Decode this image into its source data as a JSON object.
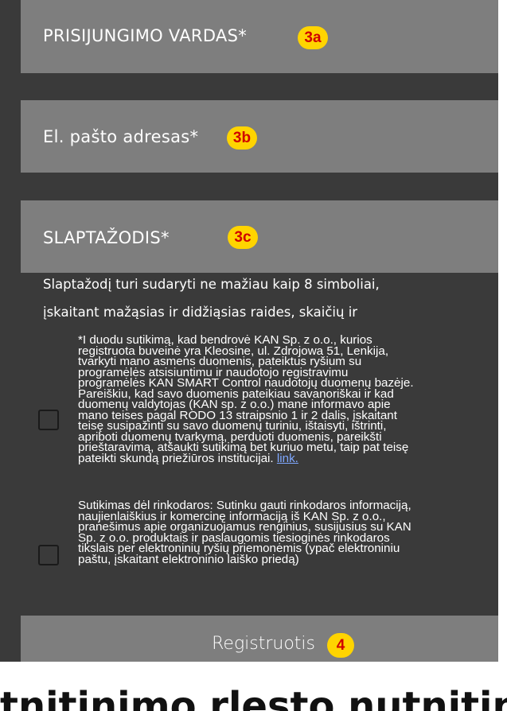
{
  "form": {
    "username": {
      "label": "PRISIJUNGIMO VARDAS*",
      "badge": "3a"
    },
    "email": {
      "label": "El. pašto adresas*",
      "badge": "3b"
    },
    "password": {
      "label": "SLAPTAŽODIS*",
      "badge": "3c"
    },
    "password_hint_line1": "Slaptažodį turi sudaryti ne mažiau kaip 8 simboliai,",
    "password_hint_line2": "įskaitant mažąsias ir didžiąsias raides, skaičių ir",
    "consent1": {
      "lines": [
        "*I duodu sutikimą, kad bendrovė KAN Sp. z o.o., kurios",
        "registruota buveinė yra Kleosine, ul. Zdrojowa 51, Lenkija,",
        "tvarkyti mano asmens duomenis, pateiktus ryšium su",
        "programėlės atsisiuntimu ir naudotojo registravimu",
        "programėlės KAN SMART Control naudotojų duomenų bazėje.",
        "Pareiškiu, kad savo duomenis pateikiau savanoriškai ir kad",
        "duomenų valdytojas (KAN sp. z o.o.) mane informavo apie",
        "mano teises pagal RODO 13 straipsnio 1 ir 2 dalis, įskaitant",
        "teisę susipažinti su savo duomenų turiniu, ištaisyti, ištrinti,",
        "apriboti duomenų tvarkymą, perduoti duomenis, pareikšti",
        "prieštaravimą, atšaukti sutikimą bet kuriuo metu, taip pat teisę"
      ],
      "last_line": "pateikti skundą priežiūros institucijai.",
      "link_text": "link."
    },
    "consent2": {
      "lines": [
        "Sutikimas dėl rinkodaros: Sutinku gauti rinkodaros informaciją,",
        "naujienlaiškius ir komercinę informaciją iš KAN Sp. z o.o.,",
        "pranešimus apie organizuojamus renginius, susijusius su KAN",
        "Sp. z o.o. produktais ir paslaugomis tiesioginės rinkodaros",
        "tikslais per elektroninių ryšių priemonėmis (ypač elektroniniu",
        "paštu, įskaitant elektroninio laiško priedą)"
      ]
    },
    "register": {
      "label": "Registruotis",
      "badge": "4"
    }
  },
  "bottom_text": "tnitinimo rlesto nutnitinimo l",
  "colors": {
    "background": "#3a3a3a",
    "field": "#7e7e7e",
    "badge": "#ffd400",
    "badge_text": "#d00000",
    "link": "#7fa8ff"
  }
}
